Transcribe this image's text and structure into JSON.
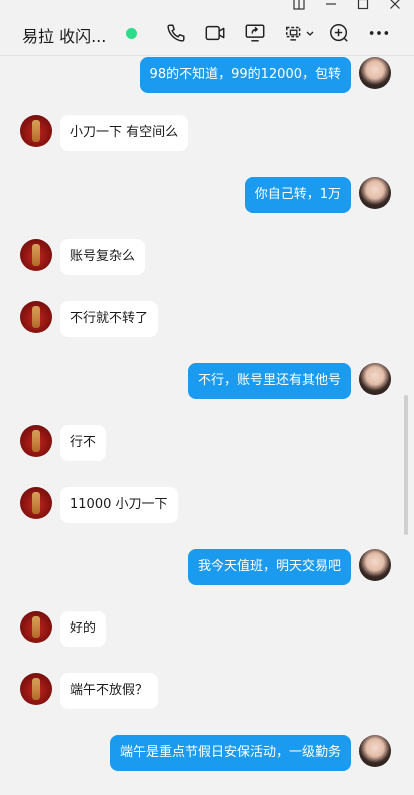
{
  "window": {
    "controls": [
      "pin-icon",
      "minimize-icon",
      "maximize-icon",
      "close-icon"
    ]
  },
  "header": {
    "title": "易拉 收闪...",
    "status_color": "#2fdc8a",
    "icons": [
      "phone-icon",
      "video-call-icon",
      "screen-share-icon",
      "remote-assist-icon",
      "add-member-icon",
      "more-icon"
    ]
  },
  "colors": {
    "self_bubble": "#1a9bf0",
    "other_bubble": "#ffffff",
    "background": "#f2f2f2"
  },
  "messages": [
    {
      "from": "self",
      "text": "98的不知道，99的12000，包转"
    },
    {
      "from": "other",
      "text": "小刀一下 有空间么"
    },
    {
      "from": "self",
      "text": "你自己转，1万"
    },
    {
      "from": "other",
      "text": "账号复杂么"
    },
    {
      "from": "other",
      "text": "不行就不转了"
    },
    {
      "from": "self",
      "text": "不行，账号里还有其他号"
    },
    {
      "from": "other",
      "text": "行不"
    },
    {
      "from": "other",
      "text": "11000 小刀一下"
    },
    {
      "from": "self",
      "text": "我今天值班，明天交易吧"
    },
    {
      "from": "other",
      "text": "好的"
    },
    {
      "from": "other",
      "text": "端午不放假？"
    },
    {
      "from": "self",
      "text": "端午是重点节假日安保活动，一级勤务"
    }
  ]
}
